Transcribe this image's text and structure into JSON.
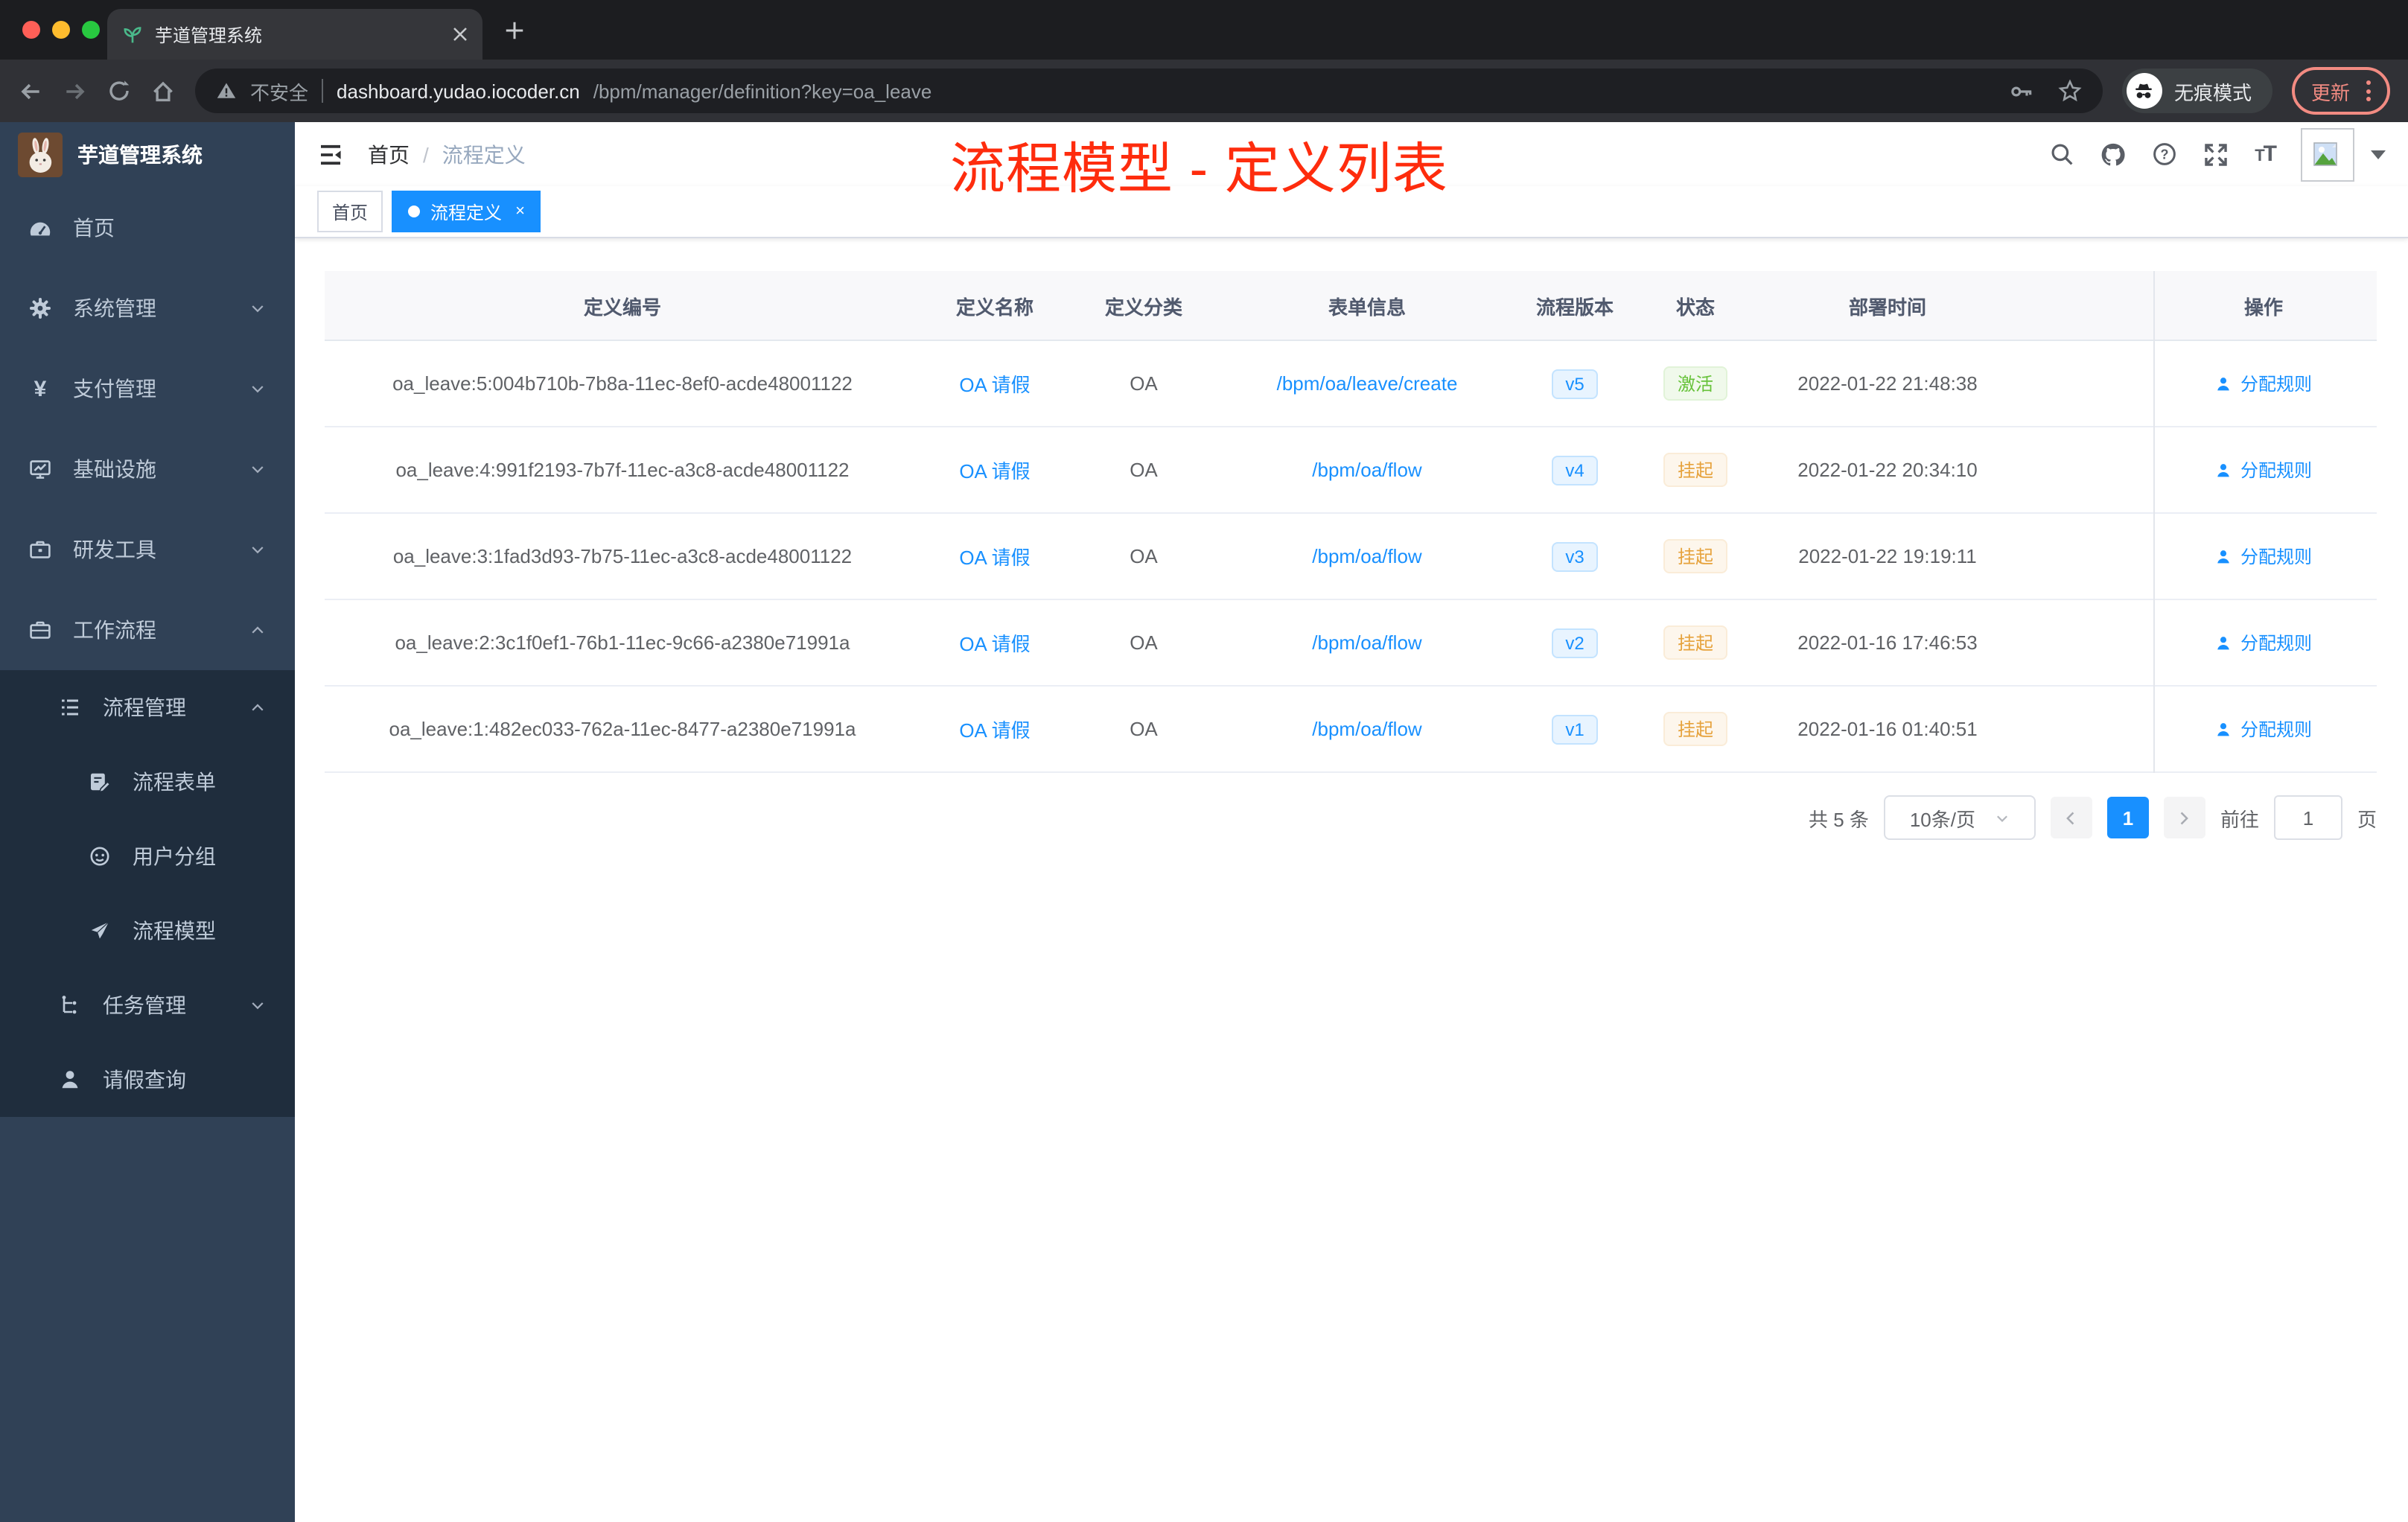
{
  "browser": {
    "tab_title": "芋道管理系统",
    "security_label": "不安全",
    "url_host": "dashboard.yudao.iocoder.cn",
    "url_path": "/bpm/manager/definition?key=oa_leave",
    "incognito_label": "无痕模式",
    "update_label": "更新"
  },
  "sidebar": {
    "logo_title": "芋道管理系统",
    "home": "首页",
    "system": "系统管理",
    "pay": "支付管理",
    "infra": "基础设施",
    "dev": "研发工具",
    "workflow": "工作流程",
    "process_mgmt": "流程管理",
    "process_form": "流程表单",
    "user_group": "用户分组",
    "process_model": "流程模型",
    "task_mgmt": "任务管理",
    "leave_query": "请假查询"
  },
  "header": {
    "breadcrumb_home": "首页",
    "breadcrumb_sep": "/",
    "breadcrumb_current": "流程定义",
    "annotation": "流程模型 - 定义列表"
  },
  "tags": {
    "home": "首页",
    "active": "流程定义",
    "close_glyph": "×"
  },
  "table": {
    "columns": {
      "id": "定义编号",
      "name": "定义名称",
      "category": "定义分类",
      "form": "表单信息",
      "version": "流程版本",
      "status": "状态",
      "deploy_time": "部署时间",
      "action": "操作"
    },
    "rows": [
      {
        "id": "oa_leave:5:004b710b-7b8a-11ec-8ef0-acde48001122",
        "name": "OA 请假",
        "category": "OA",
        "form": "/bpm/oa/leave/create",
        "version": "v5",
        "status": "激活",
        "time": "2022-01-22 21:48:38",
        "action": "分配规则"
      },
      {
        "id": "oa_leave:4:991f2193-7b7f-11ec-a3c8-acde48001122",
        "name": "OA 请假",
        "category": "OA",
        "form": "/bpm/oa/flow",
        "version": "v4",
        "status": "挂起",
        "time": "2022-01-22 20:34:10",
        "action": "分配规则"
      },
      {
        "id": "oa_leave:3:1fad3d93-7b75-11ec-a3c8-acde48001122",
        "name": "OA 请假",
        "category": "OA",
        "form": "/bpm/oa/flow",
        "version": "v3",
        "status": "挂起",
        "time": "2022-01-22 19:19:11",
        "action": "分配规则"
      },
      {
        "id": "oa_leave:2:3c1f0ef1-76b1-11ec-9c66-a2380e71991a",
        "name": "OA 请假",
        "category": "OA",
        "form": "/bpm/oa/flow",
        "version": "v2",
        "status": "挂起",
        "time": "2022-01-16 17:46:53",
        "action": "分配规则"
      },
      {
        "id": "oa_leave:1:482ec033-762a-11ec-8477-a2380e71991a",
        "name": "OA 请假",
        "category": "OA",
        "form": "/bpm/oa/flow",
        "version": "v1",
        "status": "挂起",
        "time": "2022-01-16 01:40:51",
        "action": "分配规则"
      }
    ]
  },
  "pagination": {
    "total": "共 5 条",
    "page_size": "10条/页",
    "page": "1",
    "goto_label": "前往",
    "goto_value": "1",
    "unit_label": "页"
  },
  "colors": {
    "accent": "#1890ff",
    "sidebar_bg": "#304156",
    "submenu_bg": "#1f2d3d",
    "annotation_red": "#fe2c0d",
    "status_active_green": "#67c23a",
    "status_suspend_orange": "#e6a23c"
  }
}
